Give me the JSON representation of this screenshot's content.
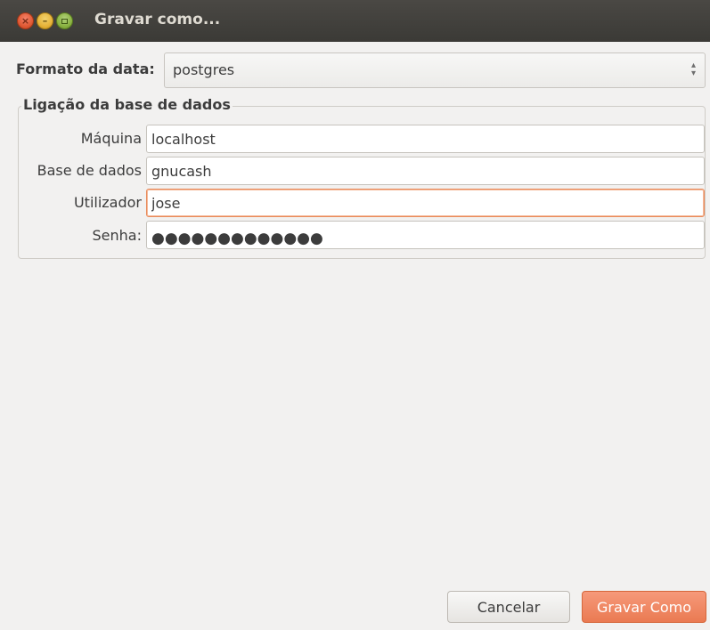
{
  "window": {
    "title": "Gravar como..."
  },
  "format": {
    "label": "Formato da data:",
    "selected": "postgres"
  },
  "connection": {
    "legend": "Ligação da base de dados",
    "host_label": "Máquina",
    "host_value": "localhost",
    "database_label": "Base de dados",
    "database_value": "gnucash",
    "user_label": "Utilizador",
    "user_value": "jose",
    "password_label": "Senha:",
    "password_masked": "●●●●●●●●●●●●●"
  },
  "buttons": {
    "cancel_label": "Cancelar",
    "save_label": "Gravar Como"
  },
  "colors": {
    "titlebar": "#3b3a36",
    "accent": "#ea7a52",
    "focus_border": "#e98a5a",
    "background": "#f2f1f0"
  },
  "icons": {
    "close": "close-icon",
    "minimize": "minimize-icon",
    "maximize": "maximize-icon",
    "combo_arrows": "updown-arrows-icon"
  }
}
